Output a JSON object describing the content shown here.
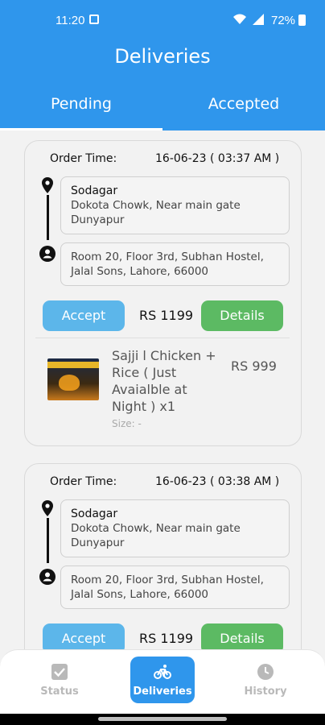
{
  "status_bar": {
    "time": "11:20",
    "battery": "72%"
  },
  "header": {
    "title": "Deliveries",
    "tabs": [
      {
        "label": "Pending",
        "active": true
      },
      {
        "label": "Accepted",
        "active": false
      }
    ]
  },
  "orders": [
    {
      "order_time_label": "Order Time:",
      "order_time": "16-06-23 ( 03:37 AM )",
      "pickup_name": "Sodagar",
      "pickup_address": "Dokota Chowk, Near main gate Dunyapur",
      "dropoff_address": "Room 20, Floor 3rd, Subhan Hostel, Jalal Sons, Lahore, 66000",
      "accept_label": "Accept",
      "total": "RS 1199",
      "details_label": "Details",
      "items": [
        {
          "name": "Sajji l Chicken + Rice  ( Just Avaialble at Night )   x1",
          "price": "RS 999",
          "size": "Size: -"
        }
      ]
    },
    {
      "order_time_label": "Order Time:",
      "order_time": "16-06-23 ( 03:38 AM )",
      "pickup_name": "Sodagar",
      "pickup_address": "Dokota Chowk, Near main gate Dunyapur",
      "dropoff_address": "Room 20, Floor 3rd, Subhan Hostel, Jalal Sons, Lahore, 66000",
      "accept_label": "Accept",
      "total": "RS 1199",
      "details_label": "Details"
    }
  ],
  "bottom_nav": [
    {
      "label": "Status",
      "icon": "checkbox-icon",
      "active": false
    },
    {
      "label": "Deliveries",
      "icon": "bicycle-icon",
      "active": true
    },
    {
      "label": "History",
      "icon": "clock-icon",
      "active": false
    }
  ],
  "colors": {
    "primary": "#2f96ec",
    "accept": "#5cb6ea",
    "details": "#5cba63"
  }
}
